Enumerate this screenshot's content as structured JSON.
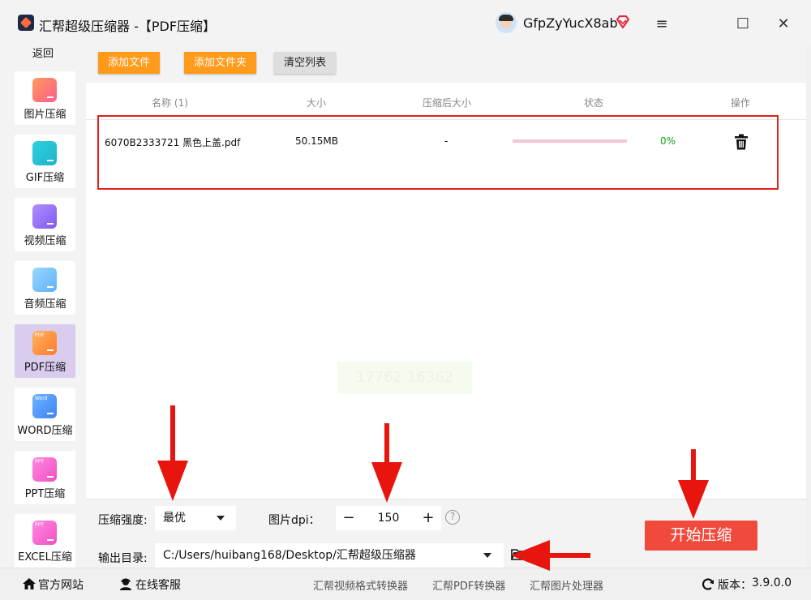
{
  "titlebar": {
    "app_title": "汇帮超级压缩器  -【PDF压缩】",
    "username": "GfpZyYucX8ab",
    "vip_color": "#e8203a",
    "menu_icon": "≡",
    "maximize_icon": "☐",
    "close_icon": "✕"
  },
  "sidebar": {
    "back": "返回",
    "items": [
      {
        "label": "图片压缩",
        "icon": "image-icon"
      },
      {
        "label": "GIF压缩",
        "icon": "gif-icon"
      },
      {
        "label": "视频压缩",
        "icon": "video-icon"
      },
      {
        "label": "音频压缩",
        "icon": "audio-icon"
      },
      {
        "label": "PDF压缩",
        "icon": "pdf-icon",
        "tag": "PDF",
        "active": true
      },
      {
        "label": "WORD压缩",
        "icon": "word-icon",
        "tag": "Word"
      },
      {
        "label": "PPT压缩",
        "icon": "ppt-icon",
        "tag": "PPT"
      },
      {
        "label": "EXCEL压缩",
        "icon": "excel-icon",
        "tag": "PPT"
      }
    ]
  },
  "toolbar": {
    "add_file": "添加文件",
    "add_folder": "添加文件夹",
    "clear_list": "清空列表"
  },
  "table": {
    "headers": {
      "name": "名称 (1)",
      "size": "大小",
      "compressed_size": "压缩后大小",
      "status": "状态",
      "action": "操作"
    },
    "rows": [
      {
        "name": "6070B2333721 黑色上盖.pdf",
        "size": "50.15MB",
        "compressed_size": "-",
        "progress": 0,
        "percent": "0%"
      }
    ]
  },
  "watermark": "17762 16362",
  "settings": {
    "strength_label": "压缩强度:",
    "strength_value": "最优",
    "dpi_label": "图片dpi：",
    "dpi_minus": "−",
    "dpi_value": "150",
    "dpi_plus": "+",
    "help": "?",
    "output_label": "输出目录:",
    "output_path": "C:/Users/huibang168/Desktop/汇帮超级压缩器",
    "start_button": "开始压缩"
  },
  "footer": {
    "website": "官方网站",
    "support": "在线客服",
    "link1": "汇帮视频格式转换器",
    "link2": "汇帮PDF转换器",
    "link3": "汇帮图片处理器",
    "version_label": "版本：",
    "version": "3.9.0.0"
  },
  "colors": {
    "accent_orange": "#ff9a1a",
    "start_red": "#f04a3c",
    "highlight_red": "#e0201a",
    "progress_track": "#f5c6d3",
    "percent_green": "#19a019",
    "active_sidebar": "#d9ccef"
  }
}
